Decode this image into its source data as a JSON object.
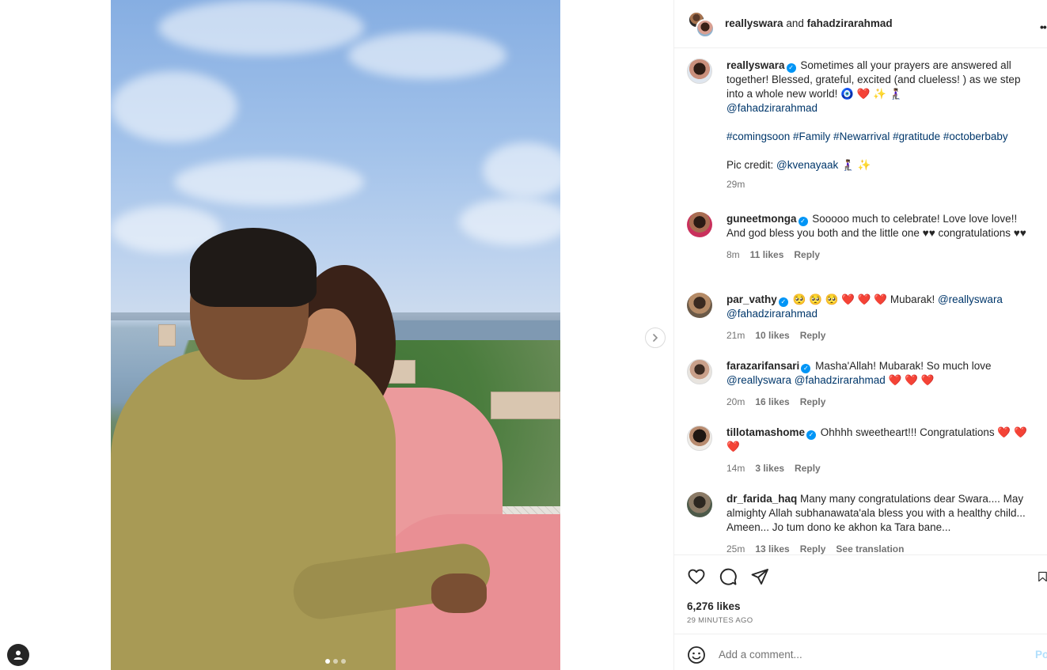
{
  "post": {
    "header_user1": "reallyswara",
    "header_joiner": "and",
    "header_user2": "fahadzirarahmad",
    "caption": {
      "username": "reallyswara",
      "text_line": "Sometimes all your prayers are answered all together! Blessed, grateful, excited (and clueless! ) as we step into a whole new world! 🧿 ❤️ ✨ 🧎🏾‍♀️",
      "mention": "@fahadzirarahmad",
      "hashtags": "#comingsoon #Family #Newarrival #gratitude #octoberbaby",
      "credit_prefix": "Pic credit:",
      "credit_mention": "@kvenayaak",
      "credit_suffix": "🧎🏾‍♀️ ✨",
      "time": "29m"
    },
    "comments": [
      {
        "username": "guneetmonga",
        "verified": true,
        "text": "Sooooo much to celebrate! Love love love!! And god bless you both and the little one ♥♥ congratulations ♥♥",
        "time": "8m",
        "likes": "11 likes",
        "reply": "Reply"
      },
      {
        "username": "par_vathy",
        "verified": true,
        "text": "🥺 🥺 🥺 ❤️ ❤️ ❤️  Mubarak!",
        "mention1": "@reallyswara",
        "mention2": "@fahadzirarahmad",
        "time": "21m",
        "likes": "10 likes",
        "reply": "Reply"
      },
      {
        "username": "farazarifansari",
        "verified": true,
        "text": "Masha'Allah! Mubarak! So much love",
        "mention1": "@reallyswara",
        "mention2": "@fahadzirarahmad",
        "hearts": "❤️ ❤️ ❤️",
        "time": "20m",
        "likes": "16 likes",
        "reply": "Reply"
      },
      {
        "username": "tillotamashome",
        "verified": true,
        "text": "Ohhhh sweetheart!!! Congratulations ❤️ ❤️ ❤️",
        "time": "14m",
        "likes": "3 likes",
        "reply": "Reply"
      },
      {
        "username": "dr_farida_haq",
        "verified": false,
        "text": "Many many congratulations dear Swara.... May almighty Allah subhanawata'ala bless you with a healthy child... Ameen... Jo tum dono ke akhon ka Tara bane...",
        "time": "25m",
        "likes": "13 likes",
        "reply": "Reply",
        "translate": "See translation"
      }
    ],
    "likes_count": "6,276 likes",
    "time_ago": "29 MINUTES AGO",
    "comment_placeholder": "Add a comment...",
    "post_button": "Po",
    "icons": {
      "like": "heart-icon",
      "comment": "comment-icon",
      "share": "share-icon",
      "save": "bookmark-icon",
      "emoji": "emoji-icon",
      "more": "more-icon",
      "next": "chevron-right-icon",
      "profile": "profile-icon"
    },
    "carousel": {
      "total": 3,
      "active": 1
    }
  },
  "colors": {
    "link": "#00376b",
    "verified": "#0095f6",
    "heart": "#ed4956",
    "muted": "#737373",
    "post_disabled": "#b2dffc"
  }
}
